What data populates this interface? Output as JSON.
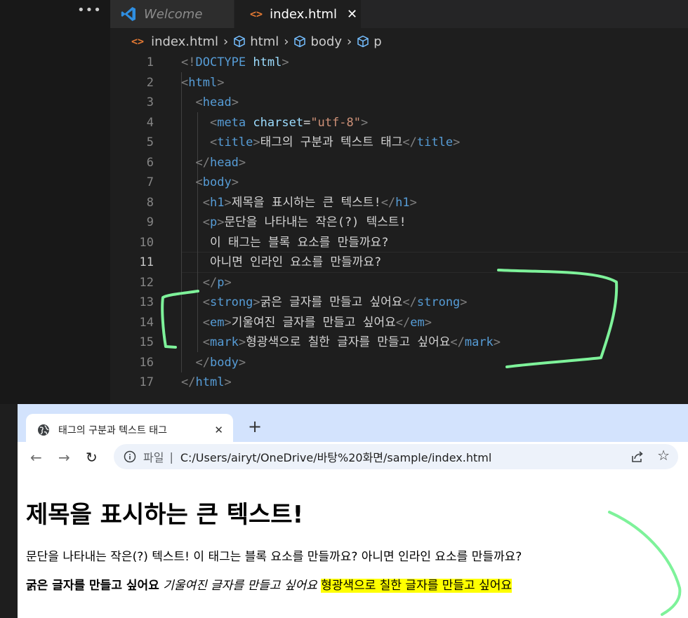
{
  "vscode": {
    "tabs": [
      {
        "label": "Welcome",
        "active": false
      },
      {
        "label": "index.html",
        "active": true
      }
    ],
    "close_glyph": "✕",
    "breadcrumb": [
      "index.html",
      "html",
      "body",
      "p"
    ],
    "active_line": 11,
    "lines": [
      {
        "n": "1",
        "tokens": [
          [
            "br",
            "<!"
          ],
          [
            "tag",
            "DOCTYPE"
          ],
          [
            "txt",
            " "
          ],
          [
            "attr",
            "html"
          ],
          [
            "br",
            ">"
          ]
        ]
      },
      {
        "n": "2",
        "tokens": [
          [
            "br",
            "<"
          ],
          [
            "tag",
            "html"
          ],
          [
            "br",
            ">"
          ]
        ]
      },
      {
        "n": "3",
        "tokens": [
          [
            "txt",
            "  "
          ],
          [
            "br",
            "<"
          ],
          [
            "tag",
            "head"
          ],
          [
            "br",
            ">"
          ]
        ]
      },
      {
        "n": "4",
        "tokens": [
          [
            "txt",
            "    "
          ],
          [
            "br",
            "<"
          ],
          [
            "tag",
            "meta"
          ],
          [
            "txt",
            " "
          ],
          [
            "attr",
            "charset"
          ],
          [
            "txt",
            "="
          ],
          [
            "str",
            "\"utf-8\""
          ],
          [
            "br",
            ">"
          ]
        ]
      },
      {
        "n": "5",
        "tokens": [
          [
            "txt",
            "    "
          ],
          [
            "br",
            "<"
          ],
          [
            "tag",
            "title"
          ],
          [
            "br",
            ">"
          ],
          [
            "txt",
            "태그의 구분과 텍스트 태그"
          ],
          [
            "br",
            "</"
          ],
          [
            "tag",
            "title"
          ],
          [
            "br",
            ">"
          ]
        ]
      },
      {
        "n": "6",
        "tokens": [
          [
            "txt",
            "  "
          ],
          [
            "br",
            "</"
          ],
          [
            "tag",
            "head"
          ],
          [
            "br",
            ">"
          ]
        ]
      },
      {
        "n": "7",
        "tokens": [
          [
            "txt",
            "  "
          ],
          [
            "br",
            "<"
          ],
          [
            "tag",
            "body"
          ],
          [
            "br",
            ">"
          ]
        ]
      },
      {
        "n": "8",
        "tokens": [
          [
            "txt",
            "   "
          ],
          [
            "br",
            "<"
          ],
          [
            "tag",
            "h1"
          ],
          [
            "br",
            ">"
          ],
          [
            "txt",
            "제목을 표시하는 큰 텍스트!"
          ],
          [
            "br",
            "</"
          ],
          [
            "tag",
            "h1"
          ],
          [
            "br",
            ">"
          ]
        ]
      },
      {
        "n": "9",
        "tokens": [
          [
            "txt",
            "   "
          ],
          [
            "br",
            "<"
          ],
          [
            "tag",
            "p"
          ],
          [
            "br",
            ">"
          ],
          [
            "txt",
            "문단을 나타내는 작은(?) 텍스트!"
          ]
        ]
      },
      {
        "n": "10",
        "tokens": [
          [
            "txt",
            "    이 태그는 블록 요소를 만들까요?"
          ]
        ]
      },
      {
        "n": "11",
        "tokens": [
          [
            "txt",
            "    아니면 인라인 요소를 만들까요?"
          ]
        ]
      },
      {
        "n": "12",
        "tokens": [
          [
            "txt",
            "   "
          ],
          [
            "br",
            "</"
          ],
          [
            "tag",
            "p"
          ],
          [
            "br",
            ">"
          ]
        ]
      },
      {
        "n": "13",
        "tokens": [
          [
            "txt",
            "   "
          ],
          [
            "br",
            "<"
          ],
          [
            "tag",
            "strong"
          ],
          [
            "br",
            ">"
          ],
          [
            "txt",
            "굵은 글자를 만들고 싶어요"
          ],
          [
            "br",
            "</"
          ],
          [
            "tag",
            "strong"
          ],
          [
            "br",
            ">"
          ]
        ]
      },
      {
        "n": "14",
        "tokens": [
          [
            "txt",
            "   "
          ],
          [
            "br",
            "<"
          ],
          [
            "tag",
            "em"
          ],
          [
            "br",
            ">"
          ],
          [
            "txt",
            "기울여진 글자를 만들고 싶어요"
          ],
          [
            "br",
            "</"
          ],
          [
            "tag",
            "em"
          ],
          [
            "br",
            ">"
          ]
        ]
      },
      {
        "n": "15",
        "tokens": [
          [
            "txt",
            "   "
          ],
          [
            "br",
            "<"
          ],
          [
            "tag",
            "mark"
          ],
          [
            "br",
            ">"
          ],
          [
            "txt",
            "형광색으로 칠한 글자를 만들고 싶어요"
          ],
          [
            "br",
            "</"
          ],
          [
            "tag",
            "mark"
          ],
          [
            "br",
            ">"
          ]
        ]
      },
      {
        "n": "16",
        "tokens": [
          [
            "txt",
            "  "
          ],
          [
            "br",
            "</"
          ],
          [
            "tag",
            "body"
          ],
          [
            "br",
            ">"
          ]
        ]
      },
      {
        "n": "17",
        "tokens": [
          [
            "br",
            "</"
          ],
          [
            "tag",
            "html"
          ],
          [
            "br",
            ">"
          ]
        ]
      }
    ]
  },
  "browser": {
    "tab_title": "태그의 구분과 텍스트 태그",
    "new_tab": "+",
    "file_label": "파일",
    "url": "C:/Users/airyt/OneDrive/바탕%20화면/sample/index.html",
    "page": {
      "h1": "제목을 표시하는 큰 텍스트!",
      "p": "문단을 나타내는 작은(?) 텍스트! 이 태그는 블록 요소를 만들까요? 아니면 인라인 요소를 만들까요?",
      "strong": "굵은 글자를 만들고 싶어요",
      "em": "기울여진 글자를 만들고 싶어요",
      "mark": "형광색으로 칠한 글자를 만들고 싶어요"
    }
  },
  "colors": {
    "tag": "#569cd6",
    "attr": "#9cdcfe",
    "string": "#ce9178",
    "bracket": "#808080",
    "annotation": "#7ef29a",
    "mark": "#ffff00"
  }
}
